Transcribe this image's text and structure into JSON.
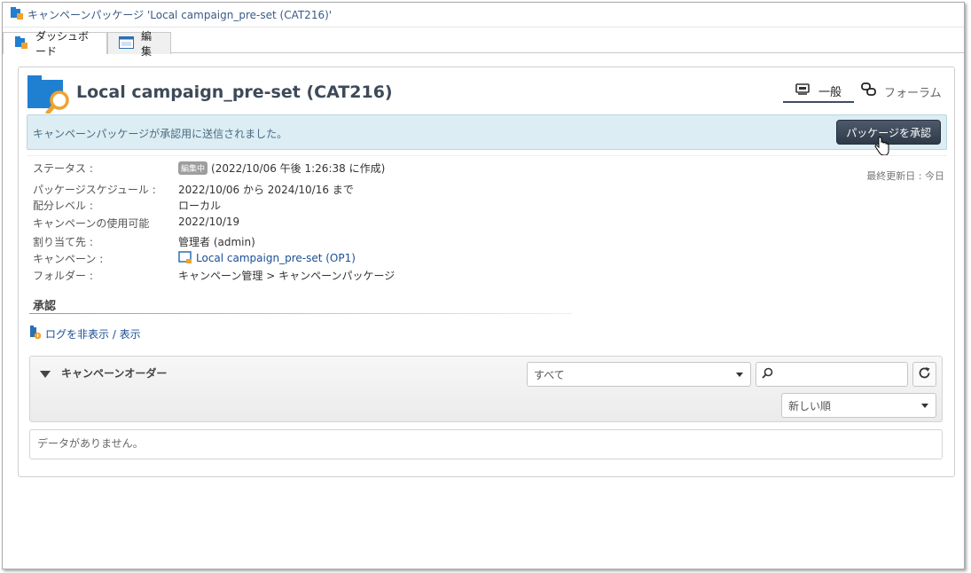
{
  "window": {
    "title": "キャンペーンパッケージ 'Local campaign_pre-set (CAT216)'",
    "tabs": [
      {
        "label": "ダッシュボード",
        "icon": "dashboard-icon"
      },
      {
        "label": "編集",
        "icon": "edit-form-icon"
      }
    ]
  },
  "header": {
    "title": "Local campaign_pre-set (CAT216)",
    "icon": "campaign-package-search-icon",
    "view_tabs": [
      {
        "label": "一般",
        "icon": "general-icon",
        "active": true
      },
      {
        "label": "フォーラム",
        "icon": "forum-icon",
        "active": false
      }
    ]
  },
  "banner": {
    "message": "キャンペーンパッケージが承認用に送信されました。",
    "approve_button": "パッケージを承認"
  },
  "last_updated": "最終更新日 : 今日",
  "info": {
    "status_label": "ステータス :",
    "status_badge": "編集中",
    "status_value": "(2022/10/06 午後 1:26:38 に作成)",
    "schedule_label": "パッケージスケジュール :",
    "schedule_value": "2022/10/06 から 2024/10/16 まで",
    "distribution_label": "配分レベル :",
    "distribution_value": "ローカル",
    "availability_label": "キャンペーンの使用可能",
    "availability_value": "2022/10/19",
    "assignee_label": "割り当て先 :",
    "assignee_value": "管理者 (admin)",
    "campaign_label": "キャンペーン :",
    "campaign_value": "Local campaign_pre-set (OP1)",
    "folder_label": "フォルダー :",
    "folder_value": "キャンペーン管理 > キャンペーンパッケージ"
  },
  "approval": {
    "title": "承認",
    "log_link": "ログを非表示 / 表示"
  },
  "orders": {
    "title": "キャンペーンオーダー",
    "filter_value": "すべて",
    "search_placeholder": "",
    "sort_value": "新しい順",
    "empty_message": "データがありません。"
  },
  "colors": {
    "banner_bg": "#dcedf3",
    "button_bg": "#3a4556",
    "link": "#1a4f96",
    "accent_orange": "#f0a22e",
    "folder_blue": "#1f7fd1"
  }
}
